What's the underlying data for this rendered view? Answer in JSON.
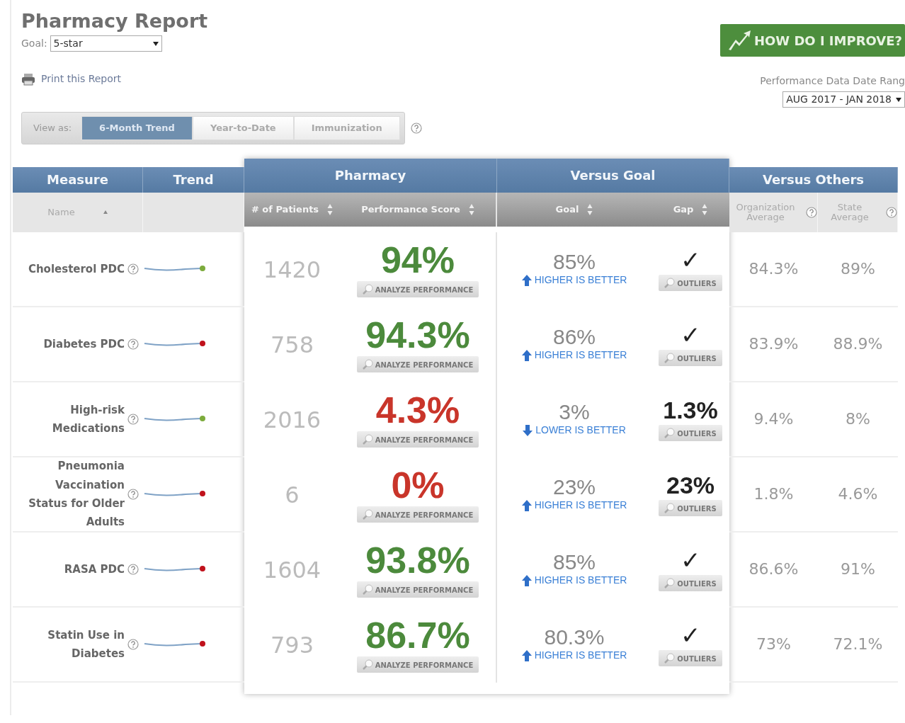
{
  "header": {
    "title": "Pharmacy Report",
    "goal_label": "Goal:",
    "goal_value": "5-star",
    "print_link": "Print this Report",
    "improve_button": "HOW DO I IMPROVE?",
    "date_range_label": "Performance Data Date Rang",
    "date_range_value": "AUG 2017 - JAN 2018"
  },
  "view_as": {
    "label": "View as:",
    "tabs": [
      {
        "label": "6-Month Trend",
        "selected": true
      },
      {
        "label": "Year-to-Date",
        "selected": false
      },
      {
        "label": "Immunization",
        "selected": false
      }
    ]
  },
  "table": {
    "groups": [
      {
        "label": "Measure"
      },
      {
        "label": "Trend"
      },
      {
        "label": "Pharmacy"
      },
      {
        "label": "Versus Goal"
      },
      {
        "label": "Versus Others"
      }
    ],
    "columns": [
      {
        "label": "Name",
        "kind": "name"
      },
      {
        "kind": "blank"
      },
      {
        "label": "# of Patients",
        "kind": "sortable"
      },
      {
        "label": "Performance Score",
        "kind": "sortable"
      },
      {
        "label": "Goal",
        "kind": "sortable"
      },
      {
        "label": "Gap",
        "kind": "sortable"
      },
      {
        "label": "Organization Average",
        "kind": "help"
      },
      {
        "label": "State Average",
        "kind": "help"
      }
    ],
    "rows": [
      {
        "name": "Cholesterol PDC",
        "color": "#7cab3c",
        "patients": "1420",
        "score": "94%",
        "met": true,
        "analyze": "ANALYZE PERFORMANCE",
        "goal": "85%",
        "higher_better": true,
        "direction_label": "HIGHER IS BETTER",
        "gap": "✓",
        "outliers": "OUTLIERS",
        "org_avg": "84.3%",
        "state_avg": "89%"
      },
      {
        "name": "Diabetes PDC",
        "color": "#c0121c",
        "patients": "758",
        "score": "94.3%",
        "met": true,
        "analyze": "ANALYZE PERFORMANCE",
        "goal": "86%",
        "higher_better": true,
        "direction_label": "HIGHER IS BETTER",
        "gap": "✓",
        "outliers": "OUTLIERS",
        "org_avg": "83.9%",
        "state_avg": "88.9%"
      },
      {
        "name": "High-risk Medications",
        "color": "#7cab3c",
        "patients": "2016",
        "score": "4.3%",
        "met": false,
        "analyze": "ANALYZE PERFORMANCE",
        "goal": "3%",
        "higher_better": false,
        "direction_label": "LOWER IS BETTER",
        "gap": "1.3%",
        "outliers": "OUTLIERS",
        "org_avg": "9.4%",
        "state_avg": "8%"
      },
      {
        "name": "Pneumonia Vaccination Status for Older Adults",
        "color": "#c0121c",
        "patients": "6",
        "score": "0%",
        "met": false,
        "analyze": "ANALYZE PERFORMANCE",
        "goal": "23%",
        "higher_better": true,
        "direction_label": "HIGHER IS BETTER",
        "gap": "23%",
        "outliers": "OUTLIERS",
        "org_avg": "1.8%",
        "state_avg": "4.6%"
      },
      {
        "name": "RASA PDC",
        "color": "#c0121c",
        "patients": "1604",
        "score": "93.8%",
        "met": true,
        "analyze": "ANALYZE PERFORMANCE",
        "goal": "85%",
        "higher_better": true,
        "direction_label": "HIGHER IS BETTER",
        "gap": "✓",
        "outliers": "OUTLIERS",
        "org_avg": "86.6%",
        "state_avg": "91%"
      },
      {
        "name": "Statin Use in Diabetes",
        "color": "#c0121c",
        "patients": "793",
        "score": "86.7%",
        "met": true,
        "analyze": "ANALYZE PERFORMANCE",
        "goal": "80.3%",
        "higher_better": true,
        "direction_label": "HIGHER IS BETTER",
        "gap": "✓",
        "outliers": "OUTLIERS",
        "org_avg": "73%",
        "state_avg": "72.1%"
      }
    ]
  }
}
